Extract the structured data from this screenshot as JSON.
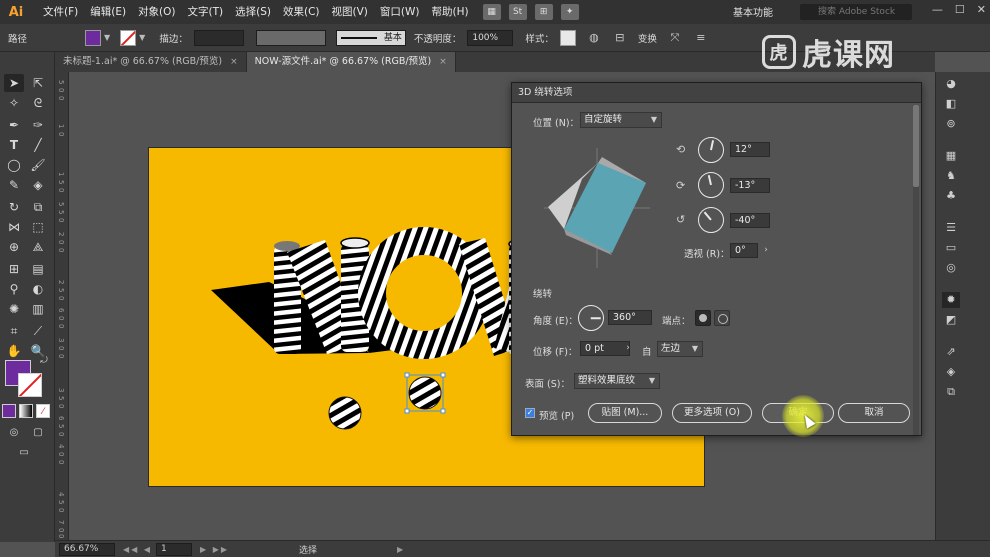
{
  "menubar": {
    "logo": "Ai",
    "items": [
      "文件(F)",
      "编辑(E)",
      "对象(O)",
      "文字(T)",
      "选择(S)",
      "效果(C)",
      "视图(V)",
      "窗口(W)",
      "帮助(H)"
    ],
    "workspace": "基本功能",
    "stock_search_placeholder": "搜索 Adobe Stock",
    "bridge_label": "St"
  },
  "watermark": {
    "logo": "虎",
    "text": "虎课网"
  },
  "controlbar": {
    "object_label": "路径",
    "fill_color": "#6d2b9e",
    "stroke_label": "描边：",
    "stroke_style": "基本",
    "opacity_label": "不透明度：",
    "opacity_value": "100%",
    "style_label": "样式：",
    "transform_label": "变换"
  },
  "tabs": [
    {
      "label": "未标题-1.ai* @ 66.67% (RGB/预览)",
      "close": "×",
      "active": false
    },
    {
      "label": "NOW-源文件.ai* @ 66.67% (RGB/预览)",
      "close": "×",
      "active": true
    }
  ],
  "ruler": {
    "marks": [
      "1",
      "0",
      "1",
      "5",
      "0",
      "2",
      "0",
      "0",
      "2",
      "5",
      "0",
      "3",
      "0",
      "0",
      "3",
      "5",
      "0",
      "4",
      "0",
      "0",
      "4",
      "5",
      "0",
      "5",
      "0",
      "0",
      "5",
      "5",
      "0",
      "6",
      "0",
      "0",
      "6",
      "5",
      "0",
      "7",
      "0",
      "0"
    ]
  },
  "artboard": {
    "color": "#f7b900"
  },
  "dialog": {
    "title": "3D 绕转选项",
    "position_label": "位置 (N)：",
    "position_value": "自定旋转",
    "x_rotation": "12°",
    "y_rotation": "-13°",
    "z_rotation": "-40°",
    "perspective_label": "透视 (R)：",
    "perspective_value": "0°",
    "revolve_label": "绕转",
    "angle_label": "角度 (E)：",
    "angle_value": "360°",
    "cap_label": "端点：",
    "offset_label": "位移 (F)：",
    "offset_value": "0 pt",
    "from_label": "自",
    "from_value": "左边",
    "surface_label": "表面 (S)：",
    "surface_value": "塑料效果底纹",
    "preview_label": "预览 (P)",
    "map_button": "贴图 (M)...",
    "more_options_button": "更多选项 (O)",
    "ok_button": "确定",
    "cancel_button": "取消",
    "cube_color": "#5ba4b4"
  },
  "statusbar": {
    "zoom": "66.67%",
    "page": "1",
    "tool_status": "选择"
  }
}
